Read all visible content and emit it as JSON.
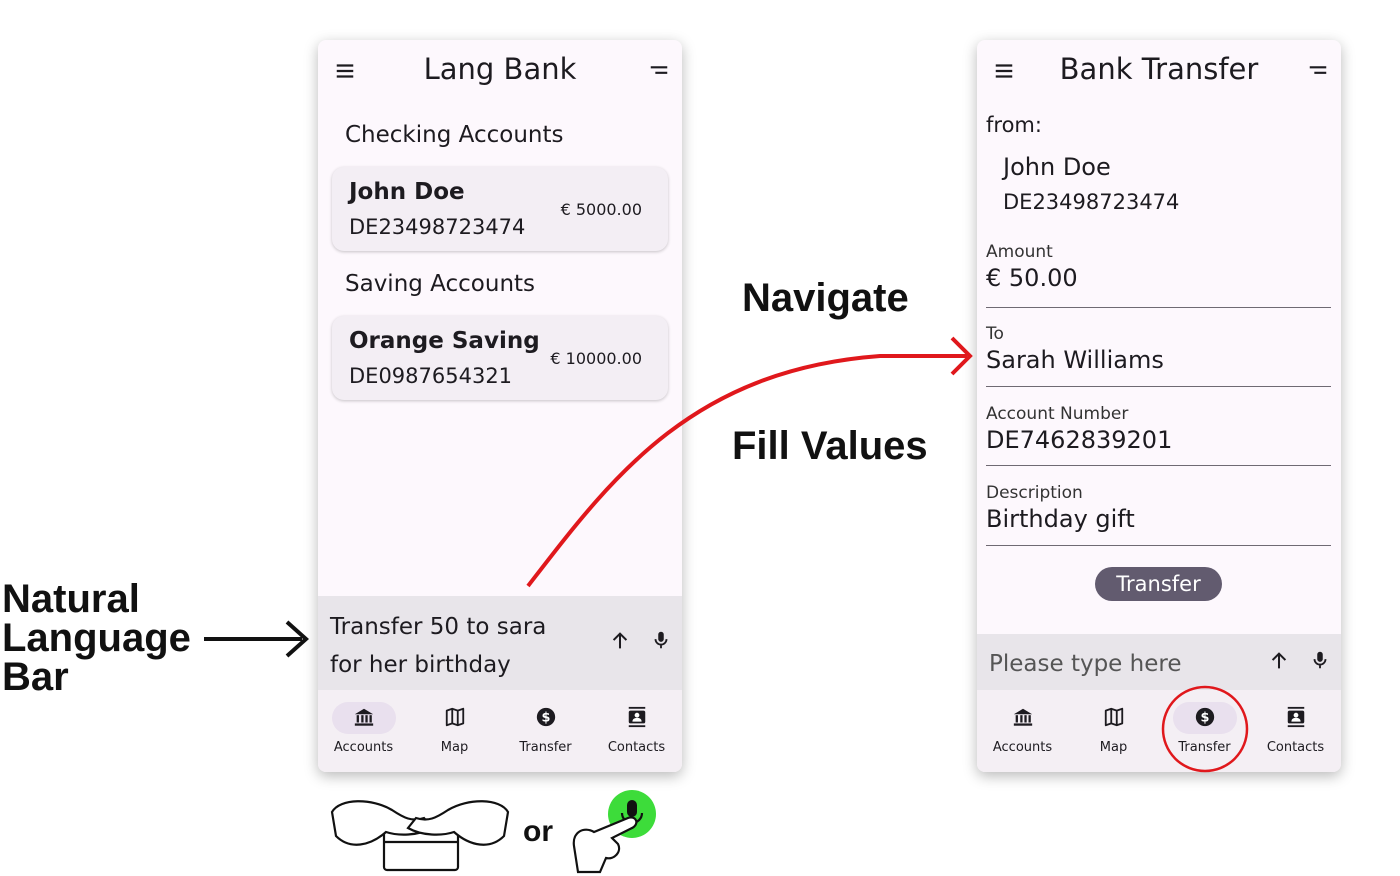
{
  "annotations": {
    "natural_language_bar": [
      "Natural",
      "Language",
      "Bar"
    ],
    "navigate": "Navigate",
    "fill_values": "Fill Values",
    "or": "or"
  },
  "screen_accounts": {
    "title": "Lang Bank",
    "checking_title": "Checking Accounts",
    "saving_title": "Saving Accounts",
    "checking": {
      "name": "John Doe",
      "iban": "DE23498723474",
      "amount": "€ 5000.00"
    },
    "saving": {
      "name": "Orange Saving",
      "iban": "DE0987654321",
      "amount": "€ 10000.00"
    },
    "input_text": "Transfer 50 to sara\nfor her birthday"
  },
  "screen_transfer": {
    "title": "Bank Transfer",
    "from_label": "from:",
    "from_name": "John Doe",
    "from_iban": "DE23498723474",
    "fields": {
      "amount": {
        "label": "Amount",
        "value": "€ 50.00"
      },
      "to": {
        "label": "To",
        "value": "Sarah Williams"
      },
      "account_number": {
        "label": "Account Number",
        "value": "DE7462839201"
      },
      "description": {
        "label": "Description",
        "value": "Birthday gift"
      }
    },
    "transfer_button": "Transfer",
    "input_placeholder": "Please type here"
  },
  "nav": {
    "accounts": "Accounts",
    "map": "Map",
    "transfer": "Transfer",
    "contacts": "Contacts"
  },
  "colors": {
    "arrow_red": "#e0181c",
    "mic_green": "#3ddc3a",
    "button": "#625b6f"
  },
  "icons": [
    "menu-icon",
    "sort-icon",
    "send-arrow-icon",
    "mic-icon",
    "bank-icon",
    "map-icon",
    "dollar-icon",
    "contacts-icon"
  ]
}
